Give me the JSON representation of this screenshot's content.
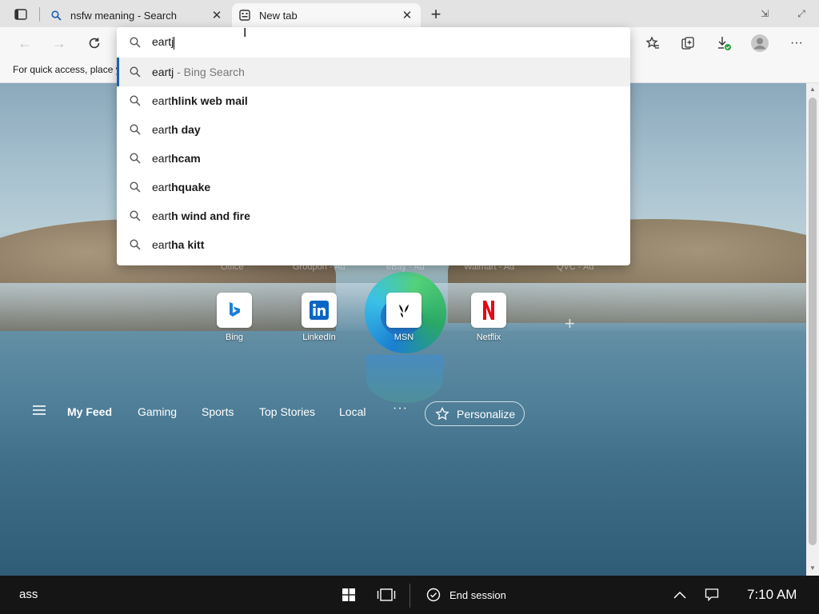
{
  "browser": {
    "tabs": [
      {
        "title": "nsfw meaning - Search",
        "active": false,
        "icon": "search-icon"
      },
      {
        "title": "New tab",
        "active": true,
        "icon": "newtab-icon"
      }
    ]
  },
  "favorites_bar": {
    "hint_text": "For quick access, place y"
  },
  "address": {
    "value": "eartj",
    "suggestions": [
      {
        "prefix": "eartj",
        "bold": "",
        "suffix": " - Bing Search",
        "selected": true
      },
      {
        "prefix": "eart",
        "bold": "hlink web mail",
        "suffix": "",
        "selected": false
      },
      {
        "prefix": "eart",
        "bold": "h day",
        "suffix": "",
        "selected": false
      },
      {
        "prefix": "eart",
        "bold": "hcam",
        "suffix": "",
        "selected": false
      },
      {
        "prefix": "eart",
        "bold": "hquake",
        "suffix": "",
        "selected": false
      },
      {
        "prefix": "eart",
        "bold": "h wind and fire",
        "suffix": "",
        "selected": false
      },
      {
        "prefix": "eart",
        "bold": "ha kitt",
        "suffix": "",
        "selected": false
      }
    ]
  },
  "new_tab": {
    "ghost_labels": [
      "Office",
      "Groupon - Ad",
      "eBay - Ad",
      "Walmart - Ad",
      "QVC - Ad"
    ],
    "quick_links": [
      {
        "label": "Bing",
        "icon": "bing-icon"
      },
      {
        "label": "LinkedIn",
        "icon": "linkedin-icon"
      },
      {
        "label": "MSN",
        "icon": "msn-icon"
      },
      {
        "label": "Netflix",
        "icon": "netflix-icon"
      }
    ],
    "feed": {
      "items": [
        "My Feed",
        "Gaming",
        "Sports",
        "Top Stories",
        "Local"
      ],
      "more": "···",
      "personalize": "Personalize"
    }
  },
  "taskbar": {
    "user": "ass",
    "end_session": "End session",
    "time": "7:10 AM"
  },
  "colors": {
    "accent": "#1e5fb3",
    "taskbar": "#151515"
  }
}
